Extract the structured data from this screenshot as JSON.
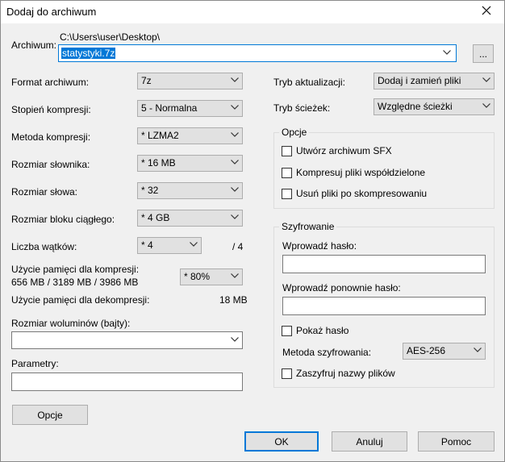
{
  "window": {
    "title": "Dodaj do archiwum"
  },
  "archive": {
    "label": "Archiwum:",
    "path": "C:\\Users\\user\\Desktop\\",
    "filename": "statystyki.7z",
    "browse_label": "..."
  },
  "left": {
    "format": {
      "label": "Format archiwum:",
      "value": "7z"
    },
    "level": {
      "label": "Stopień kompresji:",
      "value": "5 - Normalna"
    },
    "method": {
      "label": "Metoda kompresji:",
      "value": "* LZMA2"
    },
    "dict": {
      "label": "Rozmiar słownika:",
      "value": "* 16 MB"
    },
    "word": {
      "label": "Rozmiar słowa:",
      "value": "* 32"
    },
    "block": {
      "label": "Rozmiar bloku ciągłego:",
      "value": "* 4 GB"
    },
    "threads": {
      "label": "Liczba wątków:",
      "value": "* 4",
      "max": "/ 4"
    },
    "mem_comp": {
      "label": "Użycie pamięci dla kompresji:",
      "detail": "656 MB / 3189 MB / 3986 MB",
      "value": "* 80%"
    },
    "mem_decomp": {
      "label": "Użycie pamięci dla dekompresji:",
      "value": "18 MB"
    },
    "volumes": {
      "label": "Rozmiar woluminów (bajty):",
      "value": ""
    },
    "params": {
      "label": "Parametry:",
      "value": ""
    },
    "options_button": "Opcje"
  },
  "right": {
    "update": {
      "label": "Tryb aktualizacji:",
      "value": "Dodaj i zamień pliki"
    },
    "paths": {
      "label": "Tryb ścieżek:",
      "value": "Względne ścieżki"
    },
    "options": {
      "title": "Opcje",
      "sfx": "Utwórz archiwum SFX",
      "shared": "Kompresuj pliki współdzielone",
      "delete": "Usuń pliki po skompresowaniu"
    },
    "encryption": {
      "title": "Szyfrowanie",
      "password_label": "Wprowadź hasło:",
      "repeat_label": "Wprowadź ponownie hasło:",
      "show_password": "Pokaż hasło",
      "method_label": "Metoda szyfrowania:",
      "method_value": "AES-256",
      "encrypt_names": "Zaszyfruj nazwy plików"
    }
  },
  "buttons": {
    "ok": "OK",
    "cancel": "Anuluj",
    "help": "Pomoc"
  }
}
